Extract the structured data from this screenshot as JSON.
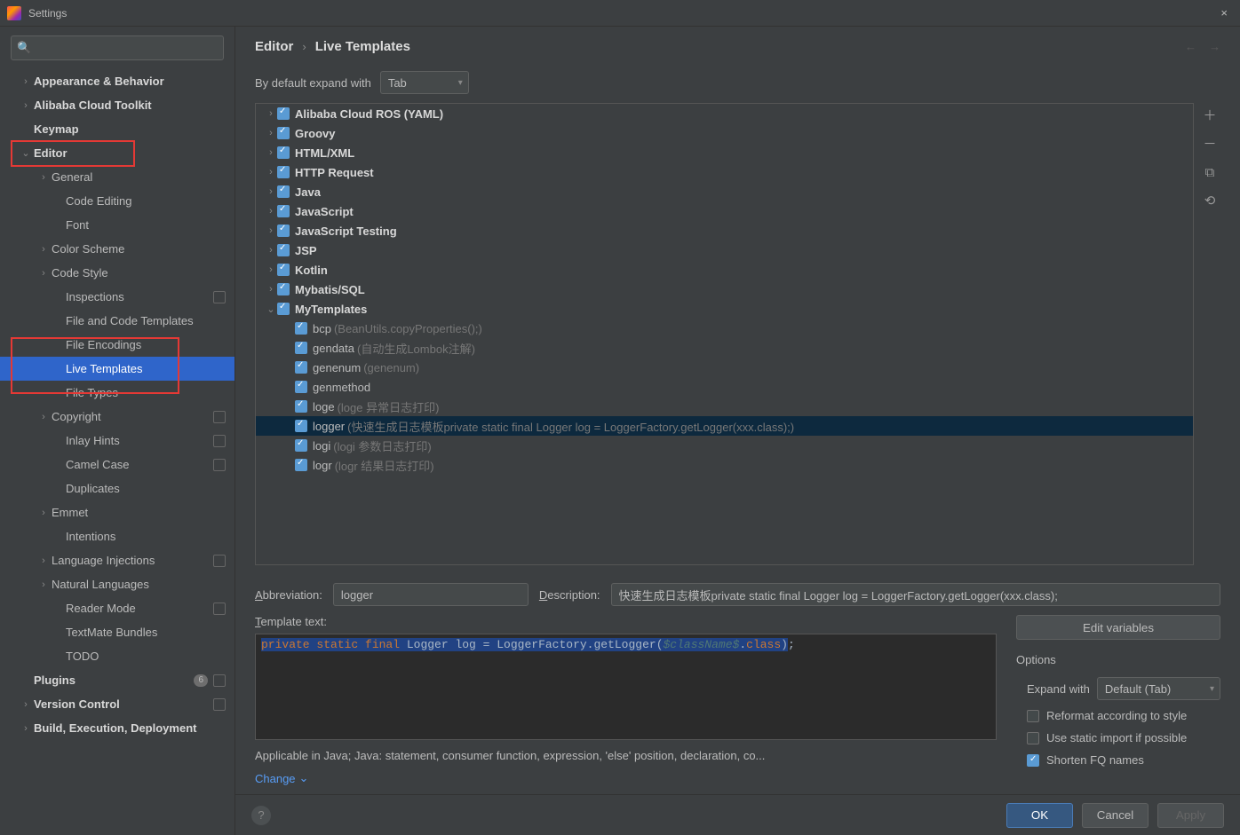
{
  "window": {
    "title": "Settings",
    "close_icon": "×"
  },
  "sidebar": {
    "search_placeholder": "",
    "items": [
      {
        "label": "Appearance & Behavior",
        "depth": 0,
        "arrow": "›",
        "bold": true
      },
      {
        "label": "Alibaba Cloud Toolkit",
        "depth": 0,
        "arrow": "›",
        "bold": true
      },
      {
        "label": "Keymap",
        "depth": 0,
        "arrow": "",
        "bold": true
      },
      {
        "label": "Editor",
        "depth": 0,
        "arrow": "⌄",
        "bold": true
      },
      {
        "label": "General",
        "depth": 1,
        "arrow": "›"
      },
      {
        "label": "Code Editing",
        "depth": 2,
        "arrow": ""
      },
      {
        "label": "Font",
        "depth": 2,
        "arrow": ""
      },
      {
        "label": "Color Scheme",
        "depth": 1,
        "arrow": "›"
      },
      {
        "label": "Code Style",
        "depth": 1,
        "arrow": "›"
      },
      {
        "label": "Inspections",
        "depth": 2,
        "arrow": "",
        "ind": true
      },
      {
        "label": "File and Code Templates",
        "depth": 2,
        "arrow": ""
      },
      {
        "label": "File Encodings",
        "depth": 2,
        "arrow": ""
      },
      {
        "label": "Live Templates",
        "depth": 2,
        "arrow": "",
        "selected": true
      },
      {
        "label": "File Types",
        "depth": 2,
        "arrow": ""
      },
      {
        "label": "Copyright",
        "depth": 1,
        "arrow": "›",
        "ind": true
      },
      {
        "label": "Inlay Hints",
        "depth": 2,
        "arrow": "",
        "ind": true
      },
      {
        "label": "Camel Case",
        "depth": 2,
        "arrow": "",
        "ind": true
      },
      {
        "label": "Duplicates",
        "depth": 2,
        "arrow": ""
      },
      {
        "label": "Emmet",
        "depth": 1,
        "arrow": "›"
      },
      {
        "label": "Intentions",
        "depth": 2,
        "arrow": ""
      },
      {
        "label": "Language Injections",
        "depth": 1,
        "arrow": "›",
        "ind": true
      },
      {
        "label": "Natural Languages",
        "depth": 1,
        "arrow": "›"
      },
      {
        "label": "Reader Mode",
        "depth": 2,
        "arrow": "",
        "ind": true
      },
      {
        "label": "TextMate Bundles",
        "depth": 2,
        "arrow": ""
      },
      {
        "label": "TODO",
        "depth": 2,
        "arrow": ""
      },
      {
        "label": "Plugins",
        "depth": 0,
        "arrow": "",
        "bold": true,
        "badge": "6",
        "ind": true
      },
      {
        "label": "Version Control",
        "depth": 0,
        "arrow": "›",
        "bold": true,
        "ind": true
      },
      {
        "label": "Build, Execution, Deployment",
        "depth": 0,
        "arrow": "›",
        "bold": true
      }
    ]
  },
  "breadcrumb": {
    "root": "Editor",
    "current": "Live Templates"
  },
  "expand": {
    "label": "By default expand with",
    "value": "Tab"
  },
  "groups": [
    {
      "name": "Alibaba Cloud ROS (YAML)",
      "arrow": "›",
      "checked": true
    },
    {
      "name": "Groovy",
      "arrow": "›",
      "checked": true
    },
    {
      "name": "HTML/XML",
      "arrow": "›",
      "checked": true
    },
    {
      "name": "HTTP Request",
      "arrow": "›",
      "checked": true
    },
    {
      "name": "Java",
      "arrow": "›",
      "checked": true
    },
    {
      "name": "JavaScript",
      "arrow": "›",
      "checked": true
    },
    {
      "name": "JavaScript Testing",
      "arrow": "›",
      "checked": true
    },
    {
      "name": "JSP",
      "arrow": "›",
      "checked": true
    },
    {
      "name": "Kotlin",
      "arrow": "›",
      "checked": true
    },
    {
      "name": "Mybatis/SQL",
      "arrow": "›",
      "checked": true
    },
    {
      "name": "MyTemplates",
      "arrow": "⌄",
      "checked": true,
      "children": [
        {
          "name": "bcp",
          "desc": "(BeanUtils.copyProperties();)",
          "checked": true
        },
        {
          "name": "gendata",
          "desc": "(自动生成Lombok注解)",
          "checked": true
        },
        {
          "name": "genenum",
          "desc": "(genenum)",
          "checked": true
        },
        {
          "name": "genmethod",
          "desc": "",
          "checked": true
        },
        {
          "name": "loge",
          "desc": "(loge 异常日志打印)",
          "checked": true
        },
        {
          "name": "logger",
          "desc": "(快速生成日志模板private static final Logger log = LoggerFactory.getLogger(xxx.class);)",
          "checked": true,
          "selected": true
        },
        {
          "name": "logi",
          "desc": "(logi  参数日志打印)",
          "checked": true
        },
        {
          "name": "logr",
          "desc": "(logr  结果日志打印)",
          "checked": true
        }
      ]
    }
  ],
  "detail": {
    "abbr_label": "Abbreviation:",
    "abbr_value": "logger",
    "desc_label": "Description:",
    "desc_value": "快速生成日志模板private static final Logger log = LoggerFactory.getLogger(xxx.class);",
    "template_text_label": "Template text:",
    "template_code": "private static final Logger log = LoggerFactory.getLogger($className$.class);",
    "edit_vars_label": "Edit variables",
    "options_title": "Options",
    "expand_with_label": "Expand with",
    "expand_with_value": "Default (Tab)",
    "reformat_label": "Reformat according to style",
    "static_import_label": "Use static import if possible",
    "shorten_fq_label": "Shorten FQ names",
    "shorten_fq_checked": true,
    "applicable": "Applicable in Java; Java: statement, consumer function, expression, 'else' position, declaration, co...",
    "change_label": "Change"
  },
  "toolbar": {
    "add": "＋",
    "remove": "－",
    "copy": "⧉",
    "revert": "⟲"
  },
  "buttons": {
    "ok": "OK",
    "cancel": "Cancel",
    "apply": "Apply",
    "help": "?"
  }
}
